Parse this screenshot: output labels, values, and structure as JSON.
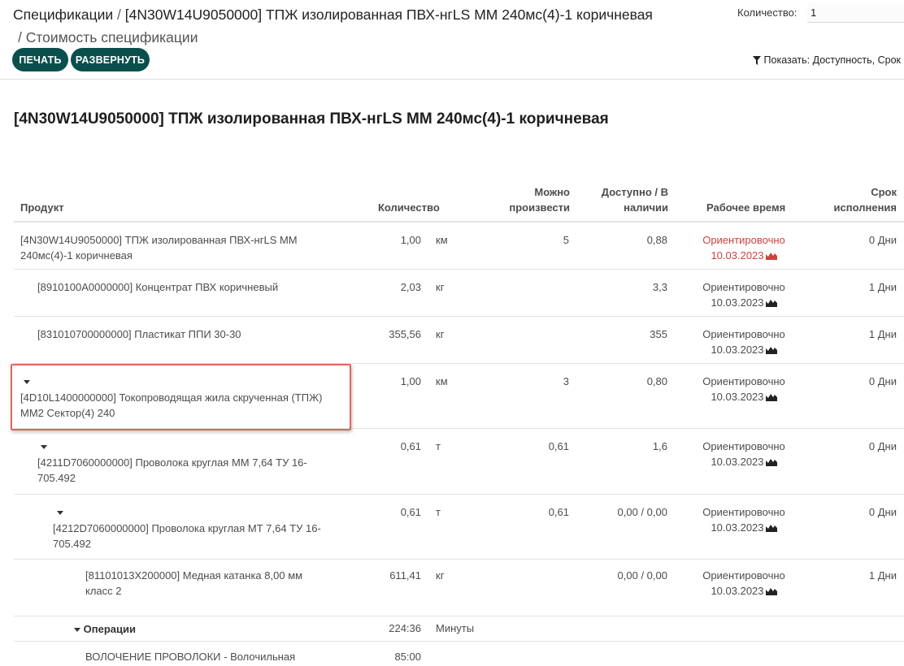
{
  "breadcrumb": {
    "root": "Спецификации",
    "separator": "/",
    "bom": "[4N30W14U9050000] ТПЖ изолированная ПВХ-нгLS ММ 240мс(4)-1 коричневая",
    "current": "/ Стоимость спецификации"
  },
  "quantity": {
    "label": "Количество:",
    "value": "1"
  },
  "buttons": {
    "print": "ПЕЧАТЬ",
    "expand": "РАЗВЕРНУТЬ"
  },
  "filter": {
    "icon": "filter-icon",
    "label": "Показать: Доступность, Срок"
  },
  "report_title": "[4N30W14U9050000] ТПЖ изолированная ПВХ-нгLS ММ 240мс(4)-1 коричневая",
  "columns": {
    "product": "Продукт",
    "quantity": "Количество",
    "producible_1": "Можно",
    "producible_2": "произвести",
    "available_1": "Доступно / В",
    "available_2": "наличии",
    "work_time": "Рабочее время",
    "lead_1": "Срок",
    "lead_2": "исполнения"
  },
  "colors": {
    "accent": "#0b4f4d",
    "warning": "#d0423c",
    "highlight": "#e0665f"
  },
  "rows": [
    {
      "product_1": "[4N30W14U9050000] ТПЖ изолированная ПВХ-нгLS ММ",
      "product_2": "240мс(4)-1 коричневая",
      "qty": "1,00",
      "uom": "км",
      "producible": "5",
      "available": "0,88",
      "time_1": "Ориентировочно",
      "time_2": "10.03.2023",
      "lead": "0 Дни",
      "late": true
    },
    {
      "product_1": "[8910100A0000000] Концентрат ПВХ коричневый",
      "product_2": "",
      "qty": "2,03",
      "uom": "кг",
      "producible": "",
      "available": "3,3",
      "time_1": "Ориентировочно",
      "time_2": "10.03.2023",
      "lead": "1 Дни",
      "late": false
    },
    {
      "product_1": "[831010700000000] Пластикат ППИ 30-30",
      "product_2": "",
      "qty": "355,56",
      "uom": "кг",
      "producible": "",
      "available": "355",
      "time_1": "Ориентировочно",
      "time_2": "10.03.2023",
      "lead": "1 Дни",
      "late": false
    },
    {
      "product_1": "[4D10L1400000000] Токопроводящая жила скрученная (ТПЖ)",
      "product_2": "ММ2 Сектор(4) 240",
      "qty": "1,00",
      "uom": "км",
      "producible": "3",
      "available": "0,80",
      "time_1": "Ориентировочно",
      "time_2": "10.03.2023",
      "lead": "0 Дни",
      "late": false
    },
    {
      "product_1": "[4211D7060000000] Проволока круглая ММ 7,64 ТУ 16-",
      "product_2": "705.492",
      "qty": "0,61",
      "uom": "т",
      "producible": "0,61",
      "available": "1,6",
      "time_1": "Ориентировочно",
      "time_2": "10.03.2023",
      "lead": "0 Дни",
      "late": false
    },
    {
      "product_1": "[4212D7060000000] Проволока круглая МТ 7,64 ТУ 16-",
      "product_2": "705.492",
      "qty": "0,61",
      "uom": "т",
      "producible": "0,61",
      "available": "0,00 / 0,00",
      "time_1": "Ориентировочно",
      "time_2": "10.03.2023",
      "lead": "0 Дни",
      "late": false
    },
    {
      "product_1": "[81101013X200000] Медная катанка 8,00 мм",
      "product_2": "класс 2",
      "qty": "611,41",
      "uom": "кг",
      "producible": "",
      "available": "0,00 / 0,00",
      "time_1": "Ориентировочно",
      "time_2": "10.03.2023",
      "lead": "1 Дни",
      "late": false
    }
  ],
  "operations": {
    "label": "Операции",
    "duration": "224:36",
    "unit": "Минуты"
  },
  "operation_rows": [
    {
      "name": "ВОЛОЧЕНИЕ ПРОВОЛОКИ - Волочильная",
      "duration": "85:00"
    }
  ]
}
